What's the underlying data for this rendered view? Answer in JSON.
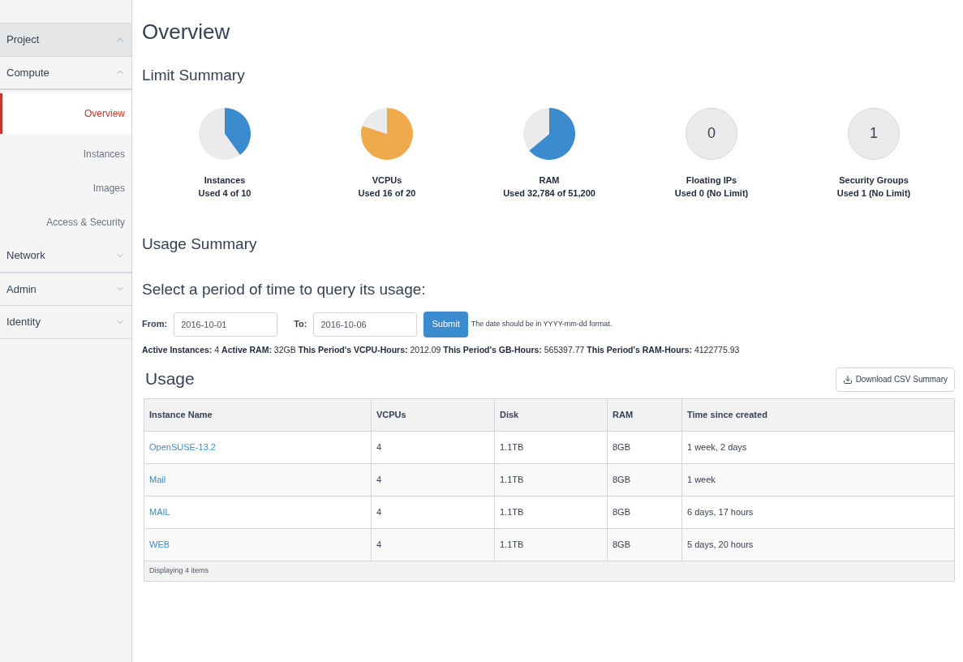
{
  "sidebar": {
    "sections": [
      {
        "label": "Project",
        "expanded": true,
        "kind": "dashboard"
      },
      {
        "label": "Compute",
        "expanded": true,
        "kind": "panel",
        "items": [
          {
            "label": "Overview",
            "selected": true
          },
          {
            "label": "Instances",
            "selected": false
          },
          {
            "label": "Images",
            "selected": false
          },
          {
            "label": "Access & Security",
            "selected": false
          }
        ]
      },
      {
        "label": "Network",
        "expanded": false,
        "kind": "panel"
      },
      {
        "label": "Admin",
        "expanded": false,
        "kind": "dashboard"
      },
      {
        "label": "Identity",
        "expanded": false,
        "kind": "dashboard"
      }
    ]
  },
  "page_title": "Overview",
  "limit_summary": {
    "title": "Limit Summary",
    "items": [
      {
        "kind": "pie",
        "label": "Instances",
        "used": "Used 4 of 10",
        "color": "#3d8bcf",
        "chart_data": {
          "type": "pie",
          "values": [
            40,
            60
          ]
        }
      },
      {
        "kind": "pie",
        "label": "VCPUs",
        "used": "Used 16 of 20",
        "color": "#efaa4c",
        "chart_data": {
          "type": "pie",
          "values": [
            80,
            20
          ]
        }
      },
      {
        "kind": "pie",
        "label": "RAM",
        "used": "Used 32,784 of 51,200",
        "color": "#3d8bcf",
        "chart_data": {
          "type": "pie",
          "values": [
            64,
            36
          ]
        }
      },
      {
        "kind": "count",
        "label": "Floating IPs",
        "used": "Used 0 (No Limit)",
        "count": "0"
      },
      {
        "kind": "count",
        "label": "Security Groups",
        "used": "Used 1 (No Limit)",
        "count": "1"
      }
    ]
  },
  "usage_summary": {
    "title": "Usage Summary",
    "prompt": "Select a period of time to query its usage:",
    "from_label": "From:",
    "from_value": "2016-10-01",
    "to_label": "To:",
    "to_value": "2016-10-06",
    "submit": "Submit",
    "hint": "The date should be in YYYY-mm-dd format.",
    "stats": "**Active Instances:** 4 **Active RAM:** 32GB **This Period's VCPU-Hours:** 2012.09 **This Period's GB-Hours:** 565397.77 **This Period's RAM-Hours:** 4122775.93"
  },
  "usage": {
    "title": "Usage",
    "download": "Download CSV Summary",
    "columns": [
      "Instance Name",
      "VCPUs",
      "Disk",
      "RAM",
      "Time since created"
    ],
    "rows": [
      [
        "OpenSUSE-13.2",
        "4",
        "1.1TB",
        "8GB",
        "1 week, 2 days"
      ],
      [
        "Mail",
        "4",
        "1.1TB",
        "8GB",
        "1 week"
      ],
      [
        "MAIL",
        "4",
        "1.1TB",
        "8GB",
        "6 days, 17 hours"
      ],
      [
        "WEB",
        "4",
        "1.1TB",
        "8GB",
        "5 days, 20 hours"
      ]
    ],
    "footer": "Displaying 4 items"
  }
}
